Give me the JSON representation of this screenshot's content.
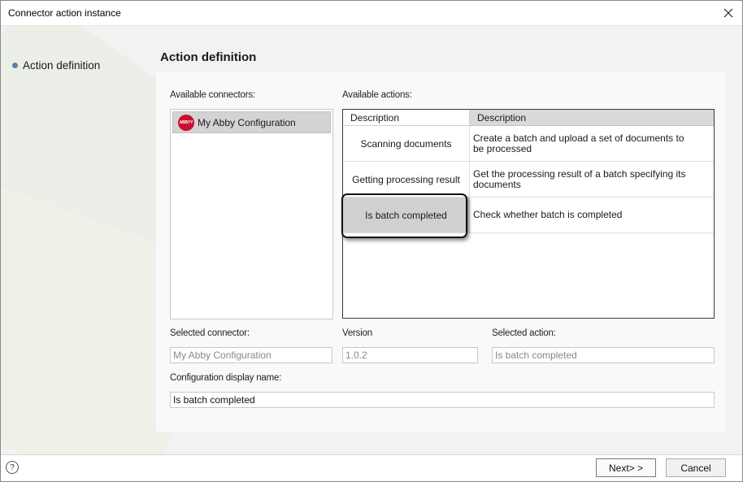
{
  "window": {
    "title": "Connector action instance"
  },
  "nav": {
    "items": [
      {
        "label": "Action definition"
      }
    ]
  },
  "main": {
    "heading": "Action definition",
    "available_connectors_label": "Available connectors:",
    "connectors": [
      {
        "label": "My Abby Configuration",
        "logo_text": "ABBYY"
      }
    ],
    "available_actions_label": "Available actions:",
    "actions_table": {
      "columns": [
        "Description",
        "Description"
      ],
      "rows": [
        {
          "name": "Scanning documents",
          "description": "Create a batch and upload a set of documents to be processed"
        },
        {
          "name": "Getting processing result",
          "description": "Get the processing result of a batch specifying its documents"
        },
        {
          "name": "Is batch completed",
          "description": "Check whether batch is completed"
        }
      ],
      "selected_row": 2
    },
    "selected_connector_label": "Selected connector:",
    "selected_connector_value": "My Abby Configuration",
    "version_label": "Version",
    "version_value": "1.0.2",
    "selected_action_label": "Selected action:",
    "selected_action_value": "Is batch completed",
    "config_display_name_label": "Configuration display name:",
    "config_display_name_value": "Is batch completed"
  },
  "footer": {
    "help_glyph": "?",
    "next_label": "Next> >",
    "cancel_label": "Cancel"
  },
  "colors": {
    "selected_row": "#d0d0d0",
    "abbyy_red": "#c8102e",
    "nav_dot": "#5f7ea8"
  }
}
